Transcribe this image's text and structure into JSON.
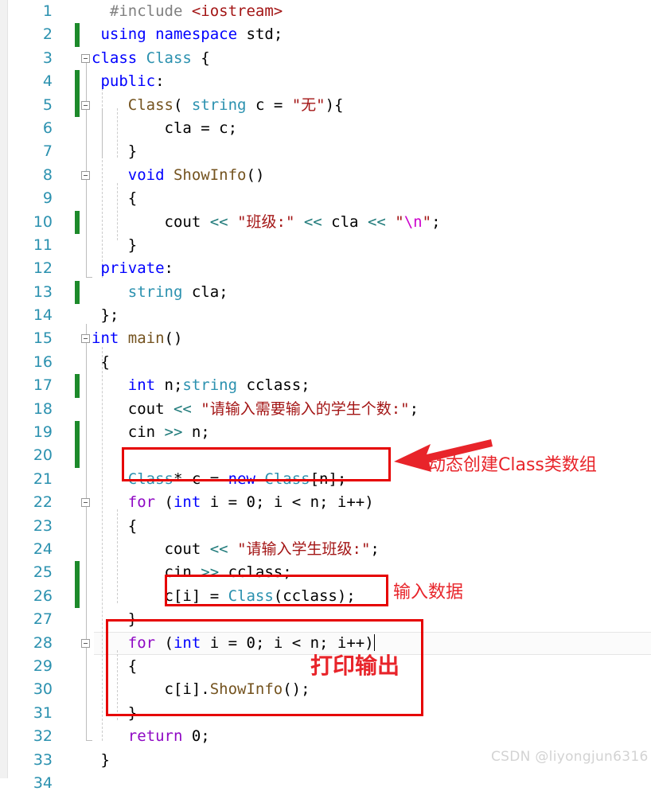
{
  "editor": {
    "language": "C++",
    "current_line": 28,
    "colors": {
      "keyword": "#0000ff",
      "control_keyword": "#8f08c4",
      "type": "#2b91af",
      "function": "#74531f",
      "string": "#a31515",
      "escape": "#cc00cc",
      "preprocessor": "#808080",
      "operator": "#1f7a7a",
      "line_number": "#2b91af",
      "change_bar": "#1d8a2b",
      "annotation_red": "#e8242a",
      "box_red": "#e60000",
      "background": "#ffffff"
    },
    "lines": [
      {
        "n": "1",
        "changed": false,
        "fold": false,
        "tokens": [
          {
            "t": "  ",
            "c": "pl"
          },
          {
            "t": "#include",
            "c": "pp"
          },
          {
            "t": " ",
            "c": "pl"
          },
          {
            "t": "<iostream>",
            "c": "inc"
          }
        ]
      },
      {
        "n": "2",
        "changed": true,
        "fold": false,
        "tokens": [
          {
            "t": " ",
            "c": "pl"
          },
          {
            "t": "using",
            "c": "kw"
          },
          {
            "t": " ",
            "c": "pl"
          },
          {
            "t": "namespace",
            "c": "kw"
          },
          {
            "t": " std;",
            "c": "pl"
          }
        ]
      },
      {
        "n": "3",
        "changed": false,
        "fold": true,
        "tokens": [
          {
            "t": "class",
            "c": "kw"
          },
          {
            "t": " ",
            "c": "pl"
          },
          {
            "t": "Class",
            "c": "type"
          },
          {
            "t": " {",
            "c": "pl"
          }
        ]
      },
      {
        "n": "4",
        "changed": true,
        "fold": false,
        "tokens": [
          {
            "t": " ",
            "c": "pl"
          },
          {
            "t": "public",
            "c": "kw"
          },
          {
            "t": ":",
            "c": "pl"
          }
        ]
      },
      {
        "n": "5",
        "changed": true,
        "fold": true,
        "tokens": [
          {
            "t": "    ",
            "c": "pl"
          },
          {
            "t": "Class",
            "c": "fn"
          },
          {
            "t": "( ",
            "c": "pl"
          },
          {
            "t": "string",
            "c": "type"
          },
          {
            "t": " c = ",
            "c": "pl"
          },
          {
            "t": "\"无\"",
            "c": "str"
          },
          {
            "t": "){",
            "c": "pl"
          }
        ]
      },
      {
        "n": "6",
        "changed": false,
        "fold": false,
        "tokens": [
          {
            "t": "        cla = c;",
            "c": "pl"
          }
        ]
      },
      {
        "n": "7",
        "changed": false,
        "fold": false,
        "tokens": [
          {
            "t": "    }",
            "c": "pl"
          }
        ]
      },
      {
        "n": "8",
        "changed": false,
        "fold": true,
        "tokens": [
          {
            "t": "    ",
            "c": "pl"
          },
          {
            "t": "void",
            "c": "kw"
          },
          {
            "t": " ",
            "c": "pl"
          },
          {
            "t": "ShowInfo",
            "c": "fn"
          },
          {
            "t": "()",
            "c": "pl"
          }
        ]
      },
      {
        "n": "9",
        "changed": false,
        "fold": false,
        "tokens": [
          {
            "t": "    {",
            "c": "pl"
          }
        ]
      },
      {
        "n": "10",
        "changed": true,
        "fold": false,
        "tokens": [
          {
            "t": "        cout ",
            "c": "pl"
          },
          {
            "t": "<<",
            "c": "op"
          },
          {
            "t": " ",
            "c": "pl"
          },
          {
            "t": "\"班级:\"",
            "c": "str"
          },
          {
            "t": " ",
            "c": "pl"
          },
          {
            "t": "<<",
            "c": "op"
          },
          {
            "t": " cla ",
            "c": "pl"
          },
          {
            "t": "<<",
            "c": "op"
          },
          {
            "t": " ",
            "c": "pl"
          },
          {
            "t": "\"",
            "c": "str"
          },
          {
            "t": "\\n",
            "c": "esc"
          },
          {
            "t": "\"",
            "c": "str"
          },
          {
            "t": ";",
            "c": "pl"
          }
        ]
      },
      {
        "n": "11",
        "changed": false,
        "fold": false,
        "tokens": [
          {
            "t": "    }",
            "c": "pl"
          }
        ]
      },
      {
        "n": "12",
        "changed": false,
        "fold": false,
        "tokens": [
          {
            "t": " ",
            "c": "pl"
          },
          {
            "t": "private",
            "c": "kw"
          },
          {
            "t": ":",
            "c": "pl"
          }
        ]
      },
      {
        "n": "13",
        "changed": true,
        "fold": false,
        "tokens": [
          {
            "t": "    ",
            "c": "pl"
          },
          {
            "t": "string",
            "c": "type"
          },
          {
            "t": " cla;",
            "c": "pl"
          }
        ]
      },
      {
        "n": "14",
        "changed": false,
        "fold": false,
        "tokens": [
          {
            "t": " };",
            "c": "pl"
          }
        ]
      },
      {
        "n": "15",
        "changed": false,
        "fold": true,
        "tokens": [
          {
            "t": "int",
            "c": "kw"
          },
          {
            "t": " ",
            "c": "pl"
          },
          {
            "t": "main",
            "c": "fn"
          },
          {
            "t": "()",
            "c": "pl"
          }
        ]
      },
      {
        "n": "16",
        "changed": false,
        "fold": false,
        "tokens": [
          {
            "t": " {",
            "c": "pl"
          }
        ]
      },
      {
        "n": "17",
        "changed": true,
        "fold": false,
        "tokens": [
          {
            "t": "    ",
            "c": "pl"
          },
          {
            "t": "int",
            "c": "kw"
          },
          {
            "t": " n;",
            "c": "pl"
          },
          {
            "t": "string",
            "c": "type"
          },
          {
            "t": " cclass;",
            "c": "pl"
          }
        ]
      },
      {
        "n": "18",
        "changed": false,
        "fold": false,
        "tokens": [
          {
            "t": "    cout ",
            "c": "pl"
          },
          {
            "t": "<<",
            "c": "op"
          },
          {
            "t": " ",
            "c": "pl"
          },
          {
            "t": "\"请输入需要输入的学生个数:\"",
            "c": "str"
          },
          {
            "t": ";",
            "c": "pl"
          }
        ]
      },
      {
        "n": "19",
        "changed": true,
        "fold": false,
        "tokens": [
          {
            "t": "    cin ",
            "c": "pl"
          },
          {
            "t": ">>",
            "c": "op"
          },
          {
            "t": " n;",
            "c": "pl"
          }
        ]
      },
      {
        "n": "20",
        "changed": true,
        "fold": false,
        "tokens": [
          {
            "t": "",
            "c": "pl"
          }
        ]
      },
      {
        "n": "21",
        "changed": false,
        "fold": false,
        "tokens": [
          {
            "t": "    ",
            "c": "pl"
          },
          {
            "t": "Class",
            "c": "type"
          },
          {
            "t": "* c = ",
            "c": "pl"
          },
          {
            "t": "new",
            "c": "kw"
          },
          {
            "t": " ",
            "c": "pl"
          },
          {
            "t": "Class",
            "c": "type"
          },
          {
            "t": "[n];",
            "c": "pl"
          }
        ]
      },
      {
        "n": "22",
        "changed": false,
        "fold": true,
        "tokens": [
          {
            "t": "    ",
            "c": "pl"
          },
          {
            "t": "for",
            "c": "kwc"
          },
          {
            "t": " (",
            "c": "pl"
          },
          {
            "t": "int",
            "c": "kw"
          },
          {
            "t": " i = 0; i < n; i++)",
            "c": "pl"
          }
        ]
      },
      {
        "n": "23",
        "changed": false,
        "fold": false,
        "tokens": [
          {
            "t": "    {",
            "c": "pl"
          }
        ]
      },
      {
        "n": "24",
        "changed": false,
        "fold": false,
        "tokens": [
          {
            "t": "        cout ",
            "c": "pl"
          },
          {
            "t": "<<",
            "c": "op"
          },
          {
            "t": " ",
            "c": "pl"
          },
          {
            "t": "\"请输入学生班级:\"",
            "c": "str"
          },
          {
            "t": ";",
            "c": "pl"
          }
        ]
      },
      {
        "n": "25",
        "changed": true,
        "fold": false,
        "tokens": [
          {
            "t": "        cin ",
            "c": "pl"
          },
          {
            "t": ">>",
            "c": "op"
          },
          {
            "t": " cclass;",
            "c": "pl"
          }
        ]
      },
      {
        "n": "26",
        "changed": true,
        "fold": false,
        "tokens": [
          {
            "t": "        c[i] = ",
            "c": "pl"
          },
          {
            "t": "Class",
            "c": "type"
          },
          {
            "t": "(cclass);",
            "c": "pl"
          }
        ]
      },
      {
        "n": "27",
        "changed": false,
        "fold": false,
        "tokens": [
          {
            "t": "    }",
            "c": "pl"
          }
        ]
      },
      {
        "n": "28",
        "changed": false,
        "fold": true,
        "tokens": [
          {
            "t": "    ",
            "c": "pl"
          },
          {
            "t": "for",
            "c": "kwc"
          },
          {
            "t": " (",
            "c": "pl"
          },
          {
            "t": "int",
            "c": "kw"
          },
          {
            "t": " i = 0; i < n; i++)",
            "c": "pl"
          }
        ]
      },
      {
        "n": "29",
        "changed": false,
        "fold": false,
        "tokens": [
          {
            "t": "    {",
            "c": "pl"
          }
        ]
      },
      {
        "n": "30",
        "changed": false,
        "fold": false,
        "tokens": [
          {
            "t": "        c[i].",
            "c": "pl"
          },
          {
            "t": "ShowInfo",
            "c": "fn"
          },
          {
            "t": "();",
            "c": "pl"
          }
        ]
      },
      {
        "n": "31",
        "changed": false,
        "fold": false,
        "tokens": [
          {
            "t": "    }",
            "c": "pl"
          }
        ]
      },
      {
        "n": "32",
        "changed": false,
        "fold": false,
        "tokens": [
          {
            "t": "    ",
            "c": "pl"
          },
          {
            "t": "return",
            "c": "kwc"
          },
          {
            "t": " 0;",
            "c": "pl"
          }
        ]
      },
      {
        "n": "33",
        "changed": false,
        "fold": false,
        "tokens": [
          {
            "t": " }",
            "c": "pl"
          }
        ]
      },
      {
        "n": "34",
        "changed": false,
        "fold": false,
        "tokens": [
          {
            "t": "",
            "c": "pl"
          }
        ]
      }
    ]
  },
  "annotations": [
    {
      "id": "create-array",
      "label": "动态创建Class类数组",
      "font_size": 22
    },
    {
      "id": "input-data",
      "label": "输入数据",
      "font_size": 22
    },
    {
      "id": "print-output",
      "label": "打印输出",
      "font_size": 28
    }
  ],
  "watermark": {
    "text": "CSDN @liyongjun6316"
  }
}
